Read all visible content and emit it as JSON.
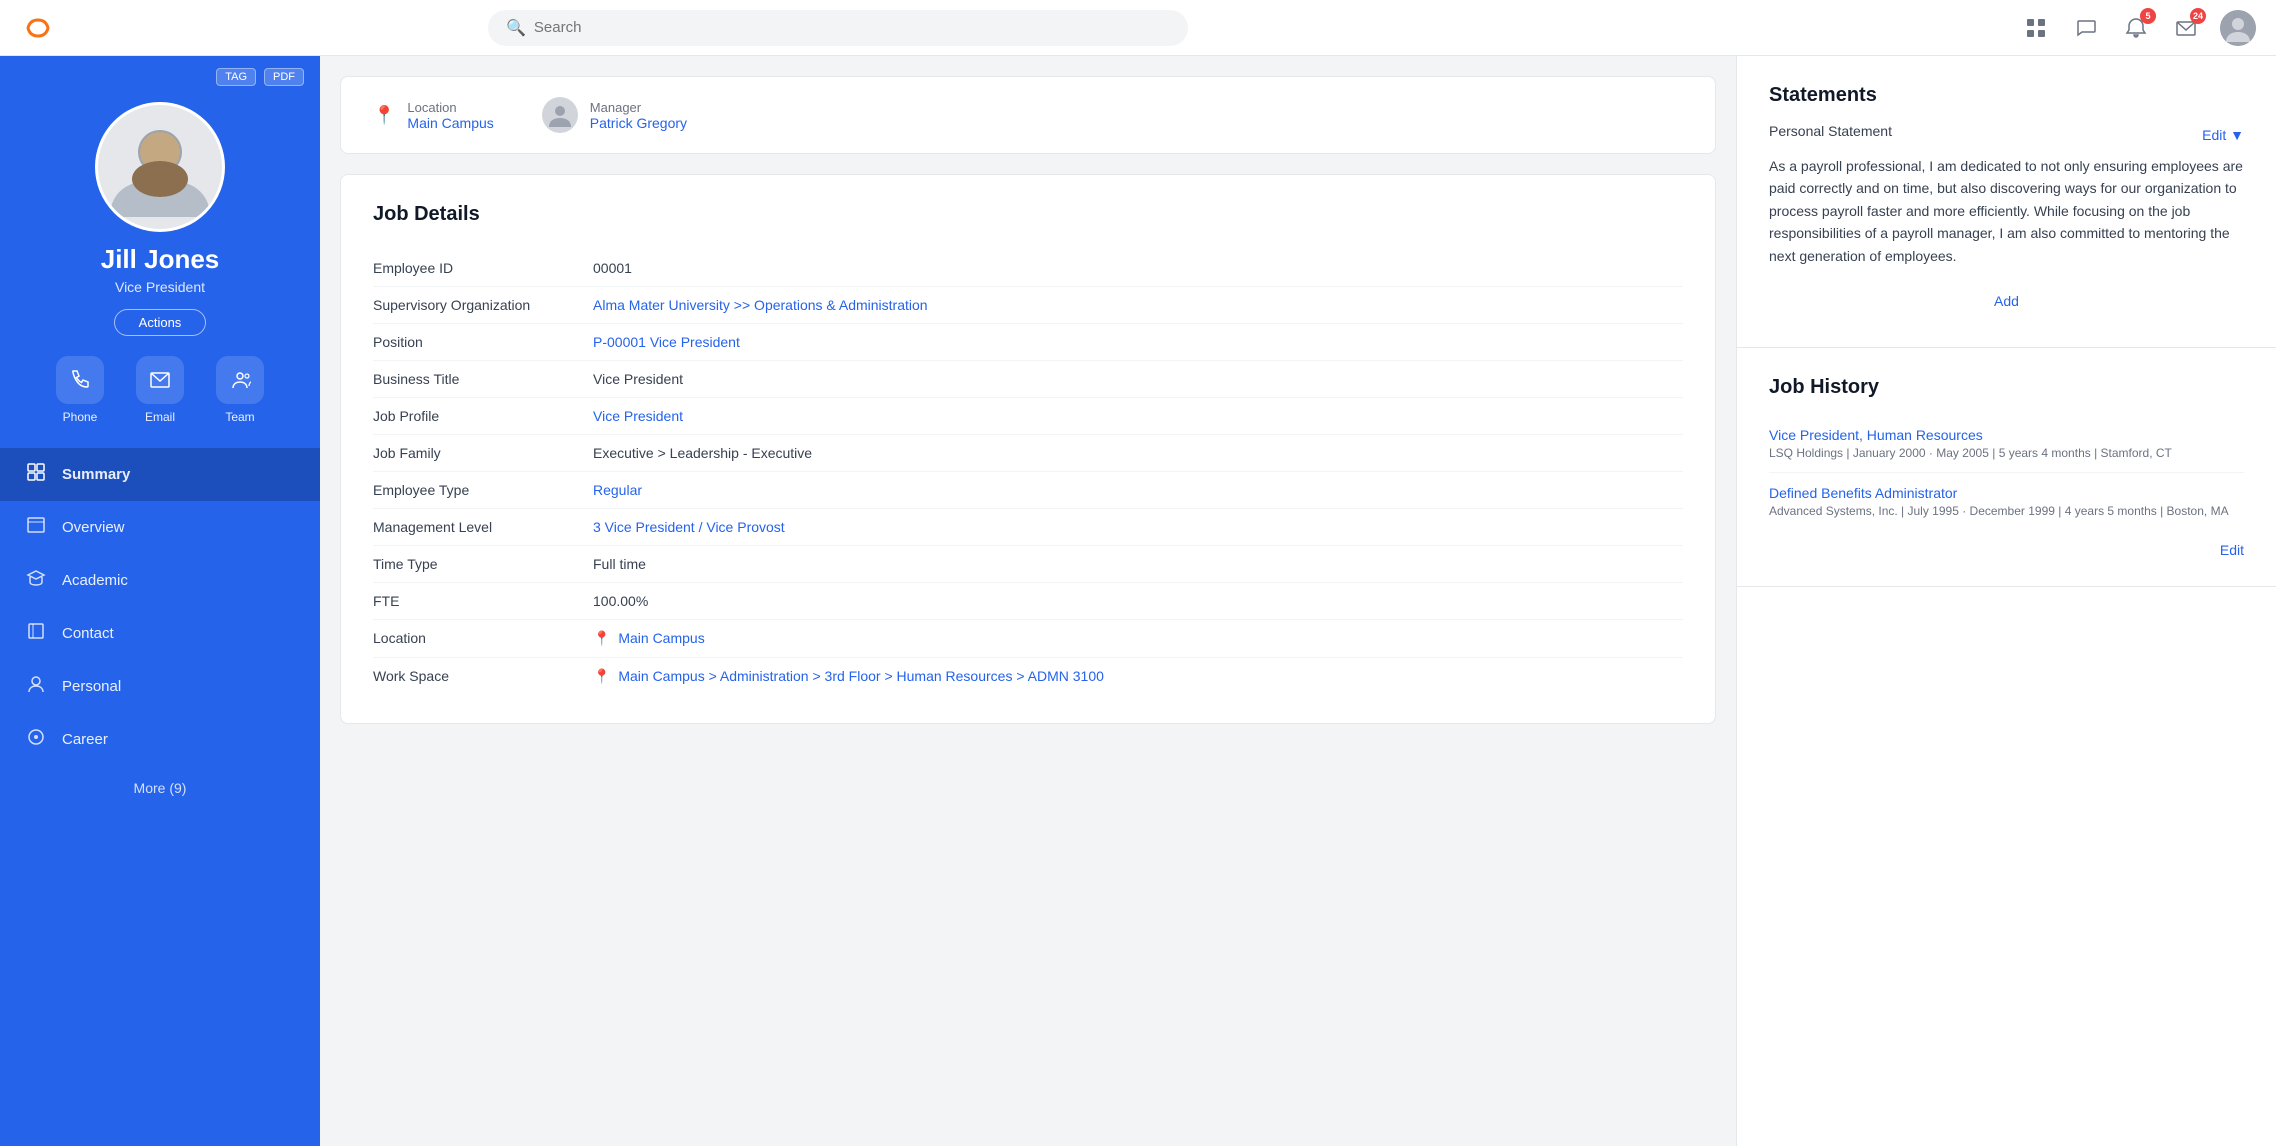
{
  "topnav": {
    "logo_alt": "Workday Logo",
    "search_placeholder": "Search",
    "notifications_count": "5",
    "messages_count": "24"
  },
  "sidebar": {
    "tag_label": "TAG",
    "pdf_label": "PDF",
    "profile_name": "Jill Jones",
    "profile_title": "Vice President",
    "actions_label": "Actions",
    "contact_icons": [
      {
        "id": "phone",
        "label": "Phone",
        "icon": "📞"
      },
      {
        "id": "email",
        "label": "Email",
        "icon": "✉️"
      },
      {
        "id": "team",
        "label": "Team",
        "icon": "🏢"
      }
    ],
    "nav_items": [
      {
        "id": "summary",
        "label": "Summary",
        "active": true
      },
      {
        "id": "overview",
        "label": "Overview",
        "active": false
      },
      {
        "id": "academic",
        "label": "Academic",
        "active": false
      },
      {
        "id": "contact",
        "label": "Contact",
        "active": false
      },
      {
        "id": "personal",
        "label": "Personal",
        "active": false
      },
      {
        "id": "career",
        "label": "Career",
        "active": false
      }
    ],
    "more_label": "More (9)"
  },
  "location_manager": {
    "location_label": "Location",
    "location_value": "Main Campus",
    "manager_label": "Manager",
    "manager_value": "Patrick Gregory"
  },
  "job_details": {
    "title": "Job Details",
    "fields": [
      {
        "label": "Employee ID",
        "value": "00001",
        "link": false
      },
      {
        "label": "Supervisory Organization",
        "value": "Alma Mater University >> Operations & Administration",
        "link": true
      },
      {
        "label": "Position",
        "value": "P-00001 Vice President",
        "link": true
      },
      {
        "label": "Business Title",
        "value": "Vice President",
        "link": false
      },
      {
        "label": "Job Profile",
        "value": "Vice President",
        "link": true
      },
      {
        "label": "Job Family",
        "value": "Executive > Leadership - Executive",
        "link": false
      },
      {
        "label": "Employee Type",
        "value": "Regular",
        "link": true
      },
      {
        "label": "Management Level",
        "value": "3 Vice President / Vice Provost",
        "link": true
      },
      {
        "label": "Time Type",
        "value": "Full time",
        "link": false
      },
      {
        "label": "FTE",
        "value": "100.00%",
        "link": false
      },
      {
        "label": "Location",
        "value": "Main Campus",
        "link": true,
        "icon": true
      },
      {
        "label": "Work Space",
        "value": "Main Campus > Administration > 3rd Floor > Human Resources > ADMN 3100",
        "link": true,
        "icon": true
      }
    ]
  },
  "statements": {
    "title": "Statements",
    "subtitle": "Personal Statement",
    "edit_label": "Edit ▼",
    "text": "As a payroll professional, I am dedicated to not only ensuring employees are paid correctly and on time, but also discovering ways for our organization to process payroll faster and more efficiently. While focusing on the job responsibilities of a payroll manager, I am also committed to mentoring the next generation of employees.",
    "add_label": "Add"
  },
  "job_history": {
    "title": "Job History",
    "edit_label": "Edit",
    "items": [
      {
        "role": "Vice President, Human Resources",
        "detail": "LSQ Holdings | January 2000 · May 2005 | 5 years 4 months | Stamford, CT"
      },
      {
        "role": "Defined Benefits Administrator",
        "detail": "Advanced Systems, Inc. | July 1995 · December 1999 | 4 years 5 months | Boston, MA"
      }
    ]
  }
}
